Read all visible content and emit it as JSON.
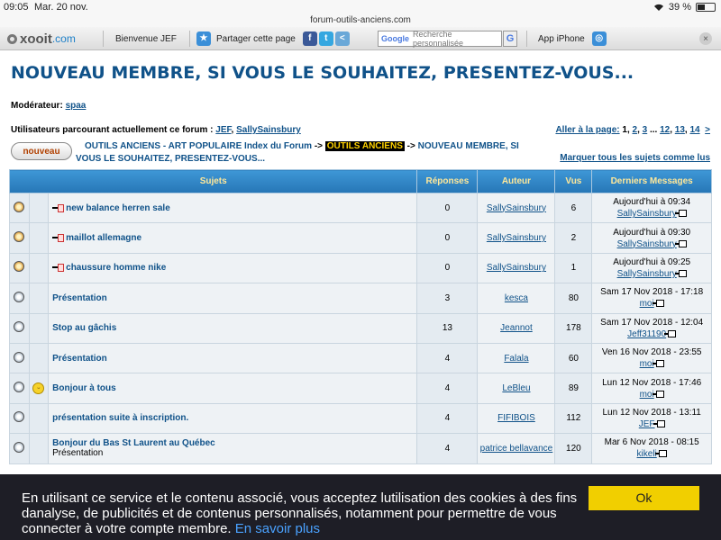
{
  "status": {
    "time": "09:05",
    "date": "Mar. 20 nov.",
    "url": "forum-outils-anciens.com",
    "battery": "39 %",
    "battery_level": 0.39
  },
  "xooit": {
    "logo": "xooit",
    "logo_tld": ".com",
    "welcome": "Bienvenue JEF",
    "share": "Partager cette page",
    "share_icons": [
      "f",
      "t",
      "<"
    ],
    "search_brand": "Google",
    "search_placeholder": "Recherche personnalisée",
    "search_button": "G",
    "app": "App iPhone",
    "close": "×"
  },
  "forum": {
    "title": "NOUVEAU MEMBRE, SI VOUS LE SOUHAITEZ, PRESENTEZ-VOUS...",
    "moderator_label": "Modérateur:",
    "moderator": "spaa",
    "users_label": "Utilisateurs parcourant actuellement ce forum :",
    "users": [
      "JEF",
      "SallySainsbury"
    ],
    "goto_page_label": "Aller à la page:",
    "pages": [
      "1",
      "2",
      "3",
      "...",
      "12",
      "13",
      "14"
    ],
    "next": ">",
    "new_button": "nouveau",
    "crumb1": "OUTILS ANCIENS - ART POPULAIRE Index du Forum",
    "crumb_sep": "->",
    "crumb2": "OUTILS ANCIENS",
    "crumb3": "NOUVEAU MEMBRE, SI VOUS LE SOUHAITEZ, PRESENTEZ-VOUS...",
    "mark_all": "Marquer tous les sujets comme lus"
  },
  "table": {
    "headers": [
      "Sujets",
      "Réponses",
      "Auteur",
      "Vus",
      "Derniers Messages"
    ],
    "rows": [
      {
        "title": "new balance herren sale",
        "sub": "",
        "replies": "0",
        "author": "SallySainsbury",
        "views": "6",
        "last_date": "Aujourd'hui à 09:34",
        "last_by": "SallySainsbury"
      },
      {
        "title": "maillot allemagne",
        "sub": "",
        "replies": "0",
        "author": "SallySainsbury",
        "views": "2",
        "last_date": "Aujourd'hui à 09:30",
        "last_by": "SallySainsbury"
      },
      {
        "title": "chaussure homme nike",
        "sub": "",
        "replies": "0",
        "author": "SallySainsbury",
        "views": "1",
        "last_date": "Aujourd'hui à 09:25",
        "last_by": "SallySainsbury"
      },
      {
        "title": "Présentation",
        "sub": "",
        "replies": "3",
        "author": "kesca",
        "views": "80",
        "last_date": "Sam 17 Nov 2018 - 17:18",
        "last_by": "moi"
      },
      {
        "title": "Stop au gâchis",
        "sub": "",
        "replies": "13",
        "author": "Jeannot",
        "views": "178",
        "last_date": "Sam 17 Nov 2018 - 12:04",
        "last_by": "Jeff31190"
      },
      {
        "title": "Présentation",
        "sub": "",
        "replies": "4",
        "author": "Falala",
        "views": "60",
        "last_date": "Ven 16 Nov 2018 - 23:55",
        "last_by": "moi"
      },
      {
        "title": "Bonjour à tous",
        "sub": "",
        "replies": "4",
        "author": "LeBleu",
        "views": "89",
        "last_date": "Lun 12 Nov 2018 - 17:46",
        "last_by": "moi"
      },
      {
        "title": "présentation suite à inscription.",
        "sub": "",
        "replies": "4",
        "author": "FIFIBOIS",
        "views": "112",
        "last_date": "Lun 12 Nov 2018 - 13:11",
        "last_by": "JEF"
      },
      {
        "title": "Bonjour du Bas St Laurent au Québec",
        "sub": "Présentation",
        "replies": "4",
        "author": "patrice bellavance",
        "views": "120",
        "last_date": "Mar 6 Nov 2018 - 08:15",
        "last_by": "kikeli"
      }
    ]
  },
  "cookie": {
    "message": "En utilisant ce service et le contenu associé, vous acceptez lutilisation des cookies à des fins danalyse, de publicités et de contenus personnalisés, notamment pour permettre de vous connecter à votre compte membre.",
    "more": "En savoir plus",
    "ok": "Ok"
  }
}
